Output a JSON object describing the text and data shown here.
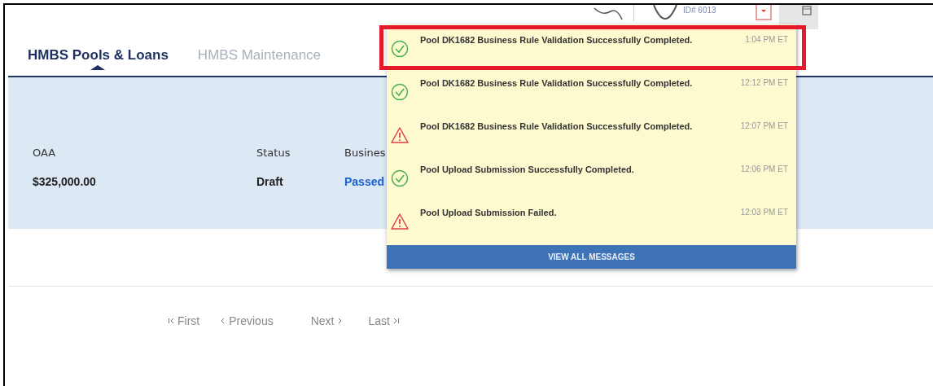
{
  "header": {
    "user_id": "ID# 6013"
  },
  "tabs": [
    {
      "label": "HMBS Pools & Loans",
      "selected": true
    },
    {
      "label": "HMBS Maintenance",
      "selected": false
    }
  ],
  "summary": [
    {
      "label": "OAA",
      "value": "$325,000.00",
      "kind": "plain"
    },
    {
      "label": "Status",
      "value": "Draft",
      "kind": "plain"
    },
    {
      "label": "Busines",
      "value": "Passed",
      "kind": "link"
    }
  ],
  "pagination": [
    {
      "label": "First",
      "kind": "first"
    },
    {
      "label": "Previous",
      "kind": "prev"
    },
    {
      "label": "Next",
      "kind": "next"
    },
    {
      "label": "Last",
      "kind": "last"
    }
  ],
  "notifications": {
    "messages": [
      {
        "kind": "success",
        "text": "Pool DK1682 Business Rule Validation Successfully Completed.",
        "time": "1:04 PM ET",
        "highlighted": true
      },
      {
        "kind": "success",
        "text": "Pool DK1682 Business Rule Validation Successfully Completed.",
        "time": "12:12 PM ET",
        "highlighted": false
      },
      {
        "kind": "warning",
        "text": "Pool DK1682 Business Rule Validation Successfully Completed.",
        "time": "12:07 PM ET",
        "highlighted": false
      },
      {
        "kind": "success",
        "text": "Pool Upload Submission Successfully Completed.",
        "time": "12:06 PM ET",
        "highlighted": false
      },
      {
        "kind": "warning",
        "text": "Pool Upload Submission Failed.",
        "time": "12:03 PM ET",
        "highlighted": false
      }
    ],
    "footer_button": "VIEW ALL MESSAGES"
  }
}
